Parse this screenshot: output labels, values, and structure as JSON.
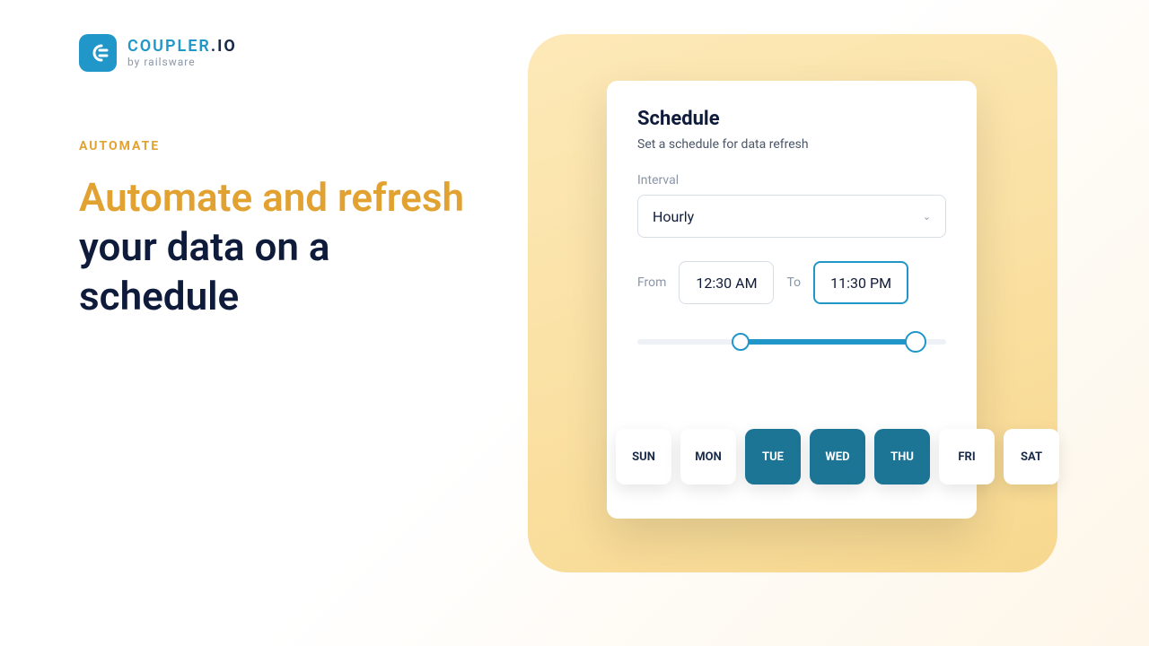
{
  "logo": {
    "line1a": "COUPLER",
    "line1b": ".IO",
    "line2": "by railsware"
  },
  "hero": {
    "eyebrow": "AUTOMATE",
    "accent": "Automate and refresh",
    "rest": " your data on a schedule"
  },
  "card": {
    "title": "Schedule",
    "subtitle": "Set a schedule for data refresh",
    "interval_label": "Interval",
    "interval_value": "Hourly",
    "from_label": "From",
    "from_value": "12:30 AM",
    "to_label": "To",
    "to_value": "11:30 PM",
    "days": [
      {
        "label": "SUN",
        "selected": false
      },
      {
        "label": "MON",
        "selected": false
      },
      {
        "label": "TUE",
        "selected": true
      },
      {
        "label": "WED",
        "selected": true
      },
      {
        "label": "THU",
        "selected": true
      },
      {
        "label": "FRI",
        "selected": false
      },
      {
        "label": "SAT",
        "selected": false
      }
    ]
  }
}
